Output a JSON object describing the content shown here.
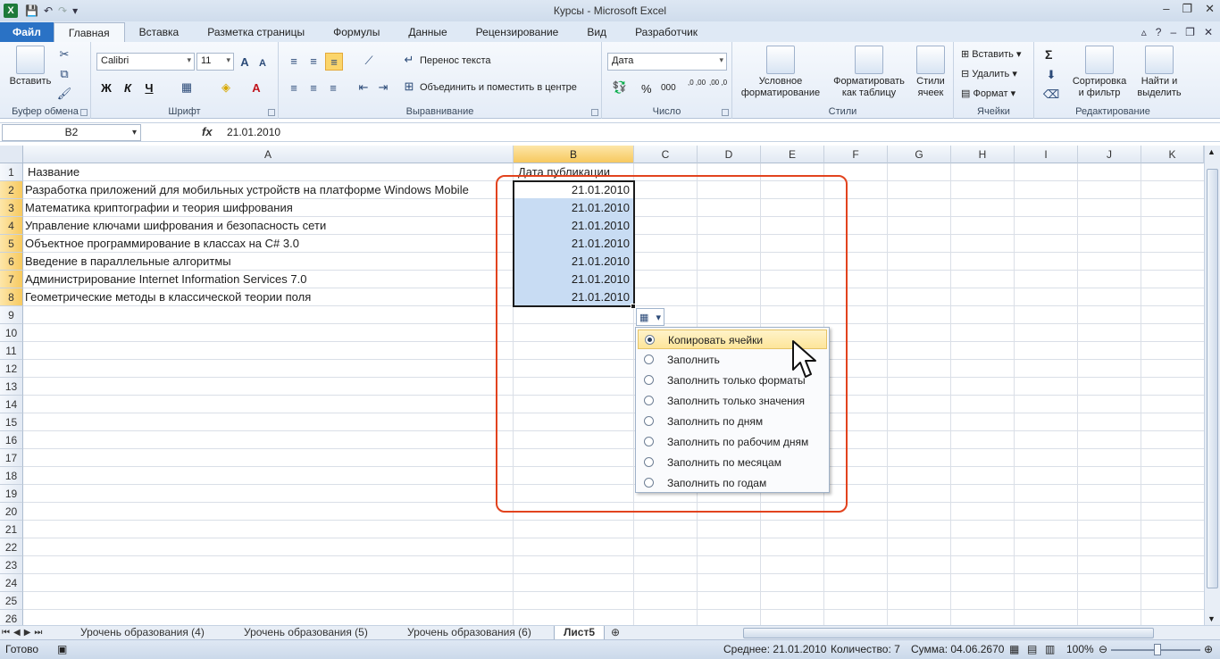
{
  "app": {
    "title": "Курсы - Microsoft Excel",
    "logo": "X"
  },
  "ribbon_tabs": [
    "Файл",
    "Главная",
    "Вставка",
    "Разметка страницы",
    "Формулы",
    "Данные",
    "Рецензирование",
    "Вид",
    "Разработчик"
  ],
  "ribbon": {
    "clipboard": {
      "paste": "Вставить",
      "label": "Буфер обмена"
    },
    "font": {
      "name": "Calibri",
      "size": "11",
      "label": "Шрифт",
      "bold": "Ж",
      "italic": "К",
      "underline": "Ч",
      "grow": "A",
      "shrink": "A",
      "color": "A"
    },
    "alignment": {
      "wrap": "Перенос текста",
      "merge": "Объединить и поместить в центре",
      "label": "Выравнивание"
    },
    "number": {
      "format": "Дата",
      "percent": "%",
      "thousands": "000",
      "inc_decimal": ",0 ,00",
      "dec_decimal": ",00 ,0",
      "label": "Число"
    },
    "styles": {
      "conditional": "Условное",
      "conditional2": "форматирование",
      "table": "Форматировать",
      "table2": "как таблицу",
      "cell": "Стили",
      "cell2": "ячеек",
      "label": "Стили"
    },
    "cells": {
      "insert": "Вставить",
      "delete": "Удалить",
      "format": "Формат",
      "label": "Ячейки"
    },
    "editing": {
      "sum": "Σ",
      "sort": "Сортировка",
      "sort2": "и фильтр",
      "find": "Найти и",
      "find2": "выделить",
      "label": "Редактирование"
    }
  },
  "formula_bar": {
    "name_box": "B2",
    "fx": "fx",
    "value": "21.01.2010"
  },
  "columns": [
    "A",
    "B",
    "C",
    "D",
    "E",
    "F",
    "G",
    "H",
    "I",
    "J",
    "K"
  ],
  "rows": [
    "1",
    "2",
    "3",
    "4",
    "5",
    "6",
    "7",
    "8",
    "9",
    "10",
    "11",
    "12",
    "13",
    "14",
    "15",
    "16",
    "17",
    "18",
    "19",
    "20",
    "21",
    "22",
    "23",
    "24",
    "25",
    "26"
  ],
  "cells": {
    "a1": "Название",
    "b1": "Дата публикации",
    "a_values": [
      "Разработка приложений для мобильных устройств на платформе Windows Mobile",
      "Математика криптографии и теория шифрования",
      "Управление ключами шифрования и безопасность сети",
      "Объектное программирование в классах на C# 3.0",
      "Введение в параллельные алгоритмы",
      "Администрирование Internet Information Services 7.0",
      "Геометрические методы в классической теории поля"
    ],
    "b_values": [
      "21.01.2010",
      "21.01.2010",
      "21.01.2010",
      "21.01.2010",
      "21.01.2010",
      "21.01.2010",
      "21.01.2010"
    ]
  },
  "autofill_menu": {
    "items": [
      {
        "label": "Копировать ячейки",
        "selected": true
      },
      {
        "label": "Заполнить",
        "selected": false
      },
      {
        "label": "Заполнить только форматы",
        "selected": false
      },
      {
        "label": "Заполнить только значения",
        "selected": false
      },
      {
        "label": "Заполнить по дням",
        "selected": false
      },
      {
        "label": "Заполнить по рабочим дням",
        "selected": false
      },
      {
        "label": "Заполнить по месяцам",
        "selected": false
      },
      {
        "label": "Заполнить по годам",
        "selected": false
      }
    ]
  },
  "sheets": [
    "Урочень образования (4)",
    "Урочень образования (5)",
    "Урочень образования (6)",
    "Лист5"
  ],
  "status": {
    "ready": "Готово",
    "average": "Среднее: 21.01.2010",
    "count": "Количество: 7",
    "sum": "Сумма: 04.06.2670",
    "zoom": "100%"
  },
  "colors": {
    "accent": "#2a72c5",
    "selection": "#c8dcf3",
    "highlight_frame": "#e2431e"
  }
}
